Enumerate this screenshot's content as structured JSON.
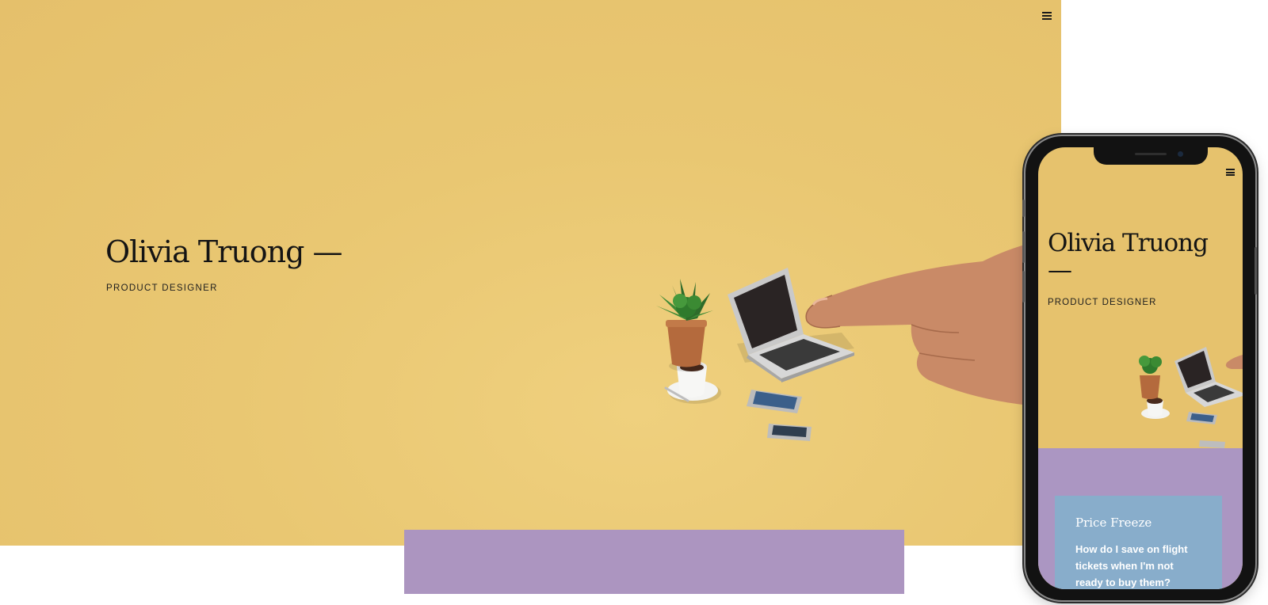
{
  "desktop": {
    "menu_icon": "hamburger-menu-icon",
    "title": "Olivia Truong —",
    "subtitle": "PRODUCT DESIGNER"
  },
  "mobile": {
    "menu_icon": "hamburger-menu-icon",
    "title": "Olivia Truong —",
    "subtitle": "PRODUCT DESIGNER",
    "card": {
      "title": "Price Freeze",
      "text": "How do I save on flight tickets when I'm not ready to buy them?"
    }
  },
  "colors": {
    "hero_yellow": "#e8c46f",
    "section_purple": "#ac95c0",
    "card_blue": "#88adcb",
    "text_dark": "#141414"
  }
}
